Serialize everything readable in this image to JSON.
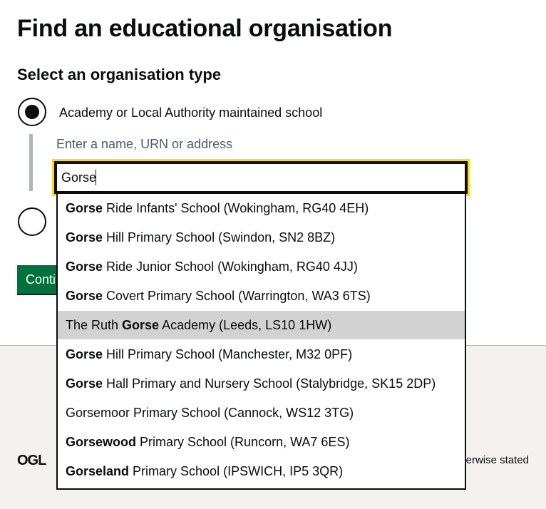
{
  "page": {
    "title": "Find an educational organisation",
    "legend": "Select an organisation type"
  },
  "radios": [
    {
      "label": "Academy or Local Authority maintained school",
      "checked": true
    },
    {
      "label": "",
      "checked": false
    }
  ],
  "search": {
    "hint": "Enter a name, URN or address",
    "value": "Gorse"
  },
  "continue_button": {
    "label": "Continue"
  },
  "footer": {
    "logo": "OGL",
    "licence_text_visible": "erwise stated"
  },
  "dropdown": {
    "highlighted_index": 4,
    "options": [
      {
        "pre": "",
        "bold": "Gorse",
        "post": " Ride Infants' School (Wokingham, RG40 4EH)"
      },
      {
        "pre": "",
        "bold": "Gorse",
        "post": " Hill Primary School (Swindon, SN2 8BZ)"
      },
      {
        "pre": "",
        "bold": "Gorse",
        "post": " Ride Junior School (Wokingham, RG40 4JJ)"
      },
      {
        "pre": "",
        "bold": "Gorse",
        "post": " Covert Primary School (Warrington, WA3 6TS)"
      },
      {
        "pre": "The Ruth ",
        "bold": "Gorse",
        "post": " Academy (Leeds, LS10 1HW)"
      },
      {
        "pre": "",
        "bold": "Gorse",
        "post": " Hill Primary School (Manchester, M32 0PF)"
      },
      {
        "pre": "",
        "bold": "Gorse",
        "post": " Hall Primary and Nursery School (Stalybridge, SK15 2DP)"
      },
      {
        "pre": "Gorsemoor Primary School (Cannock, WS12 3TG)",
        "bold": "",
        "post": ""
      },
      {
        "pre": "",
        "bold": "Gorsewood",
        "post": " Primary School (Runcorn, WA7 6ES)"
      },
      {
        "pre": "",
        "bold": "Gorseland",
        "post": " Primary School (IPSWICH, IP5 3QR)"
      }
    ]
  }
}
